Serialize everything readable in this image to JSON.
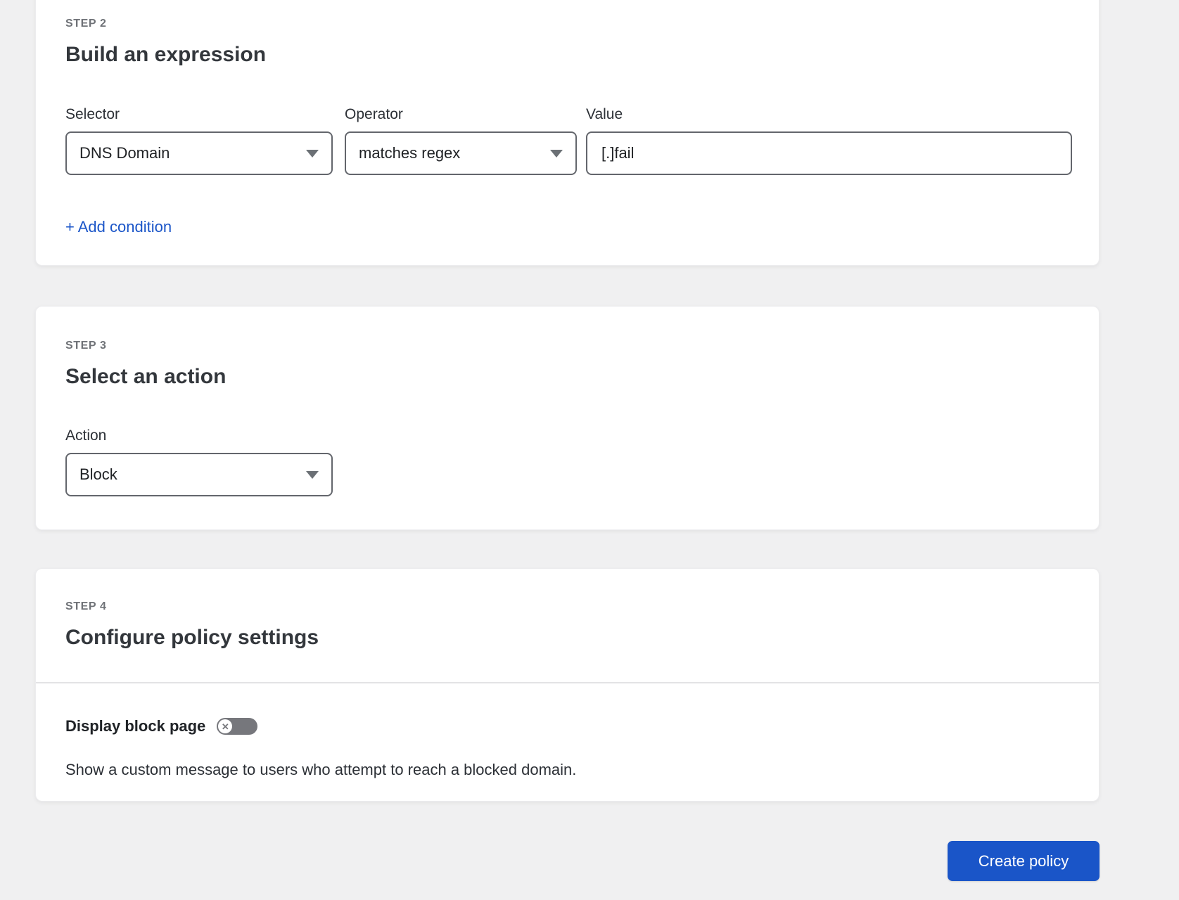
{
  "page": {
    "background": "#f0f0f1",
    "accent_blue": "#1a55c8"
  },
  "step2": {
    "step_label": "STEP 2",
    "title": "Build an expression",
    "fields": [
      {
        "label": "Selector",
        "value": "DNS Domain",
        "control": "select"
      },
      {
        "label": "Operator",
        "value": "matches regex",
        "control": "select"
      },
      {
        "label": "Value",
        "value": "[.]fail",
        "control": "text-input"
      }
    ],
    "add_condition_label": "+ Add condition"
  },
  "step3": {
    "step_label": "STEP 3",
    "title": "Select an action",
    "action_label": "Action",
    "action_value": "Block"
  },
  "step4": {
    "step_label": "STEP 4",
    "title": "Configure policy settings",
    "toggle_label": "Display block page",
    "toggle_state": "off",
    "toggle_icon": "x",
    "description": "Show a custom message to users who attempt to reach a blocked domain."
  },
  "footer": {
    "create_button_label": "Create policy"
  }
}
